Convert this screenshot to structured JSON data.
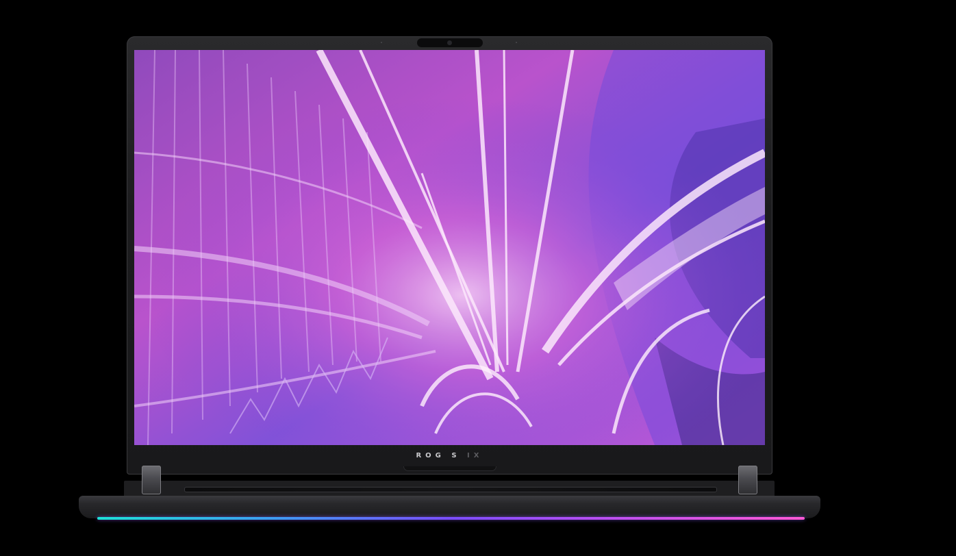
{
  "device": {
    "brand_mark": "ROG S",
    "brand_mark_faded": "  IX",
    "lightbar_colors": [
      "#1de0d6",
      "#3d9cf2",
      "#7b4dff",
      "#b64ef2",
      "#ff58d4"
    ],
    "screen_colors": {
      "base": "#7a3cc4",
      "magenta": "#e04fd0",
      "violet": "#6a3ad6",
      "light": "#f4d6f7"
    }
  }
}
